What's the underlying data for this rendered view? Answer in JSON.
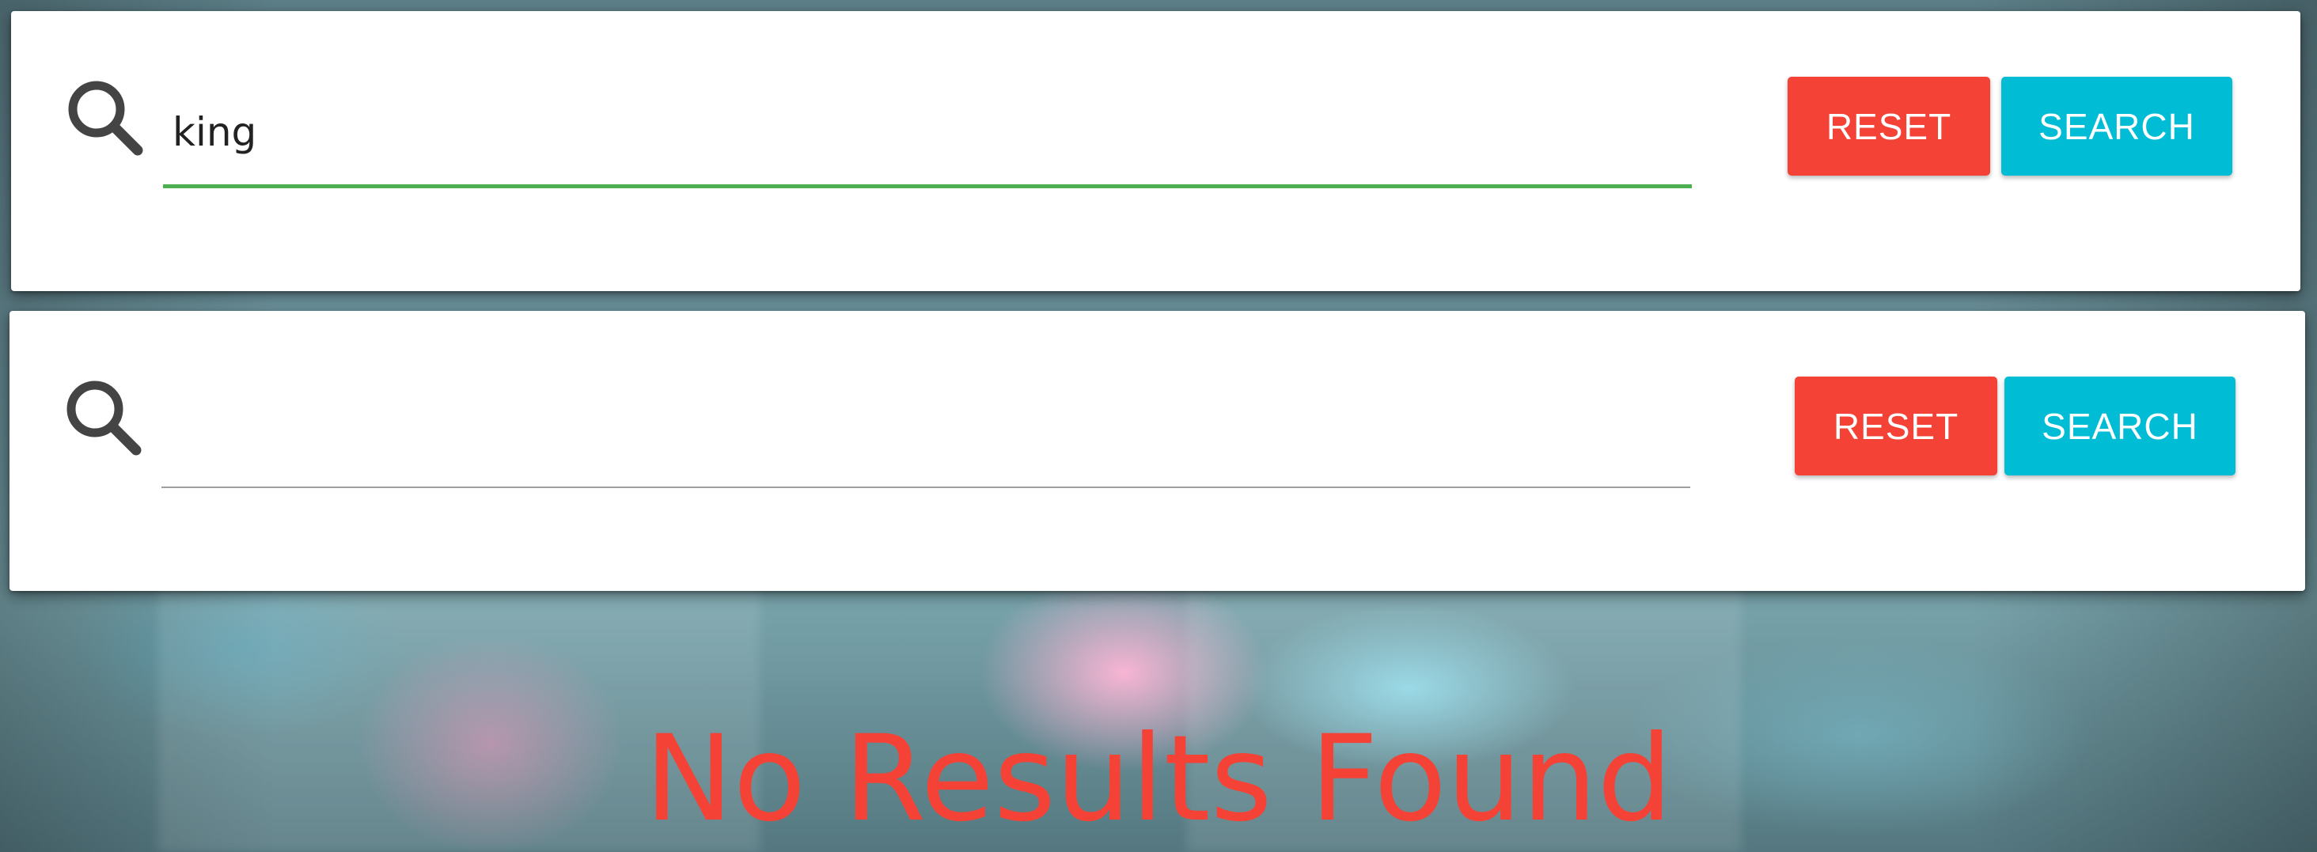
{
  "search_bars": [
    {
      "query": "king",
      "placeholder": "",
      "reset_label": "RESET",
      "search_label": "SEARCH",
      "focused": true
    },
    {
      "query": "",
      "placeholder": "",
      "reset_label": "RESET",
      "search_label": "SEARCH",
      "focused": false
    }
  ],
  "results": {
    "message": "No Results Found"
  },
  "colors": {
    "reset_button": "#f44336",
    "search_button": "#00bcd4",
    "focus_underline": "#4caf50",
    "no_results_text": "#f44336"
  },
  "icons": {
    "search": "search-icon"
  }
}
